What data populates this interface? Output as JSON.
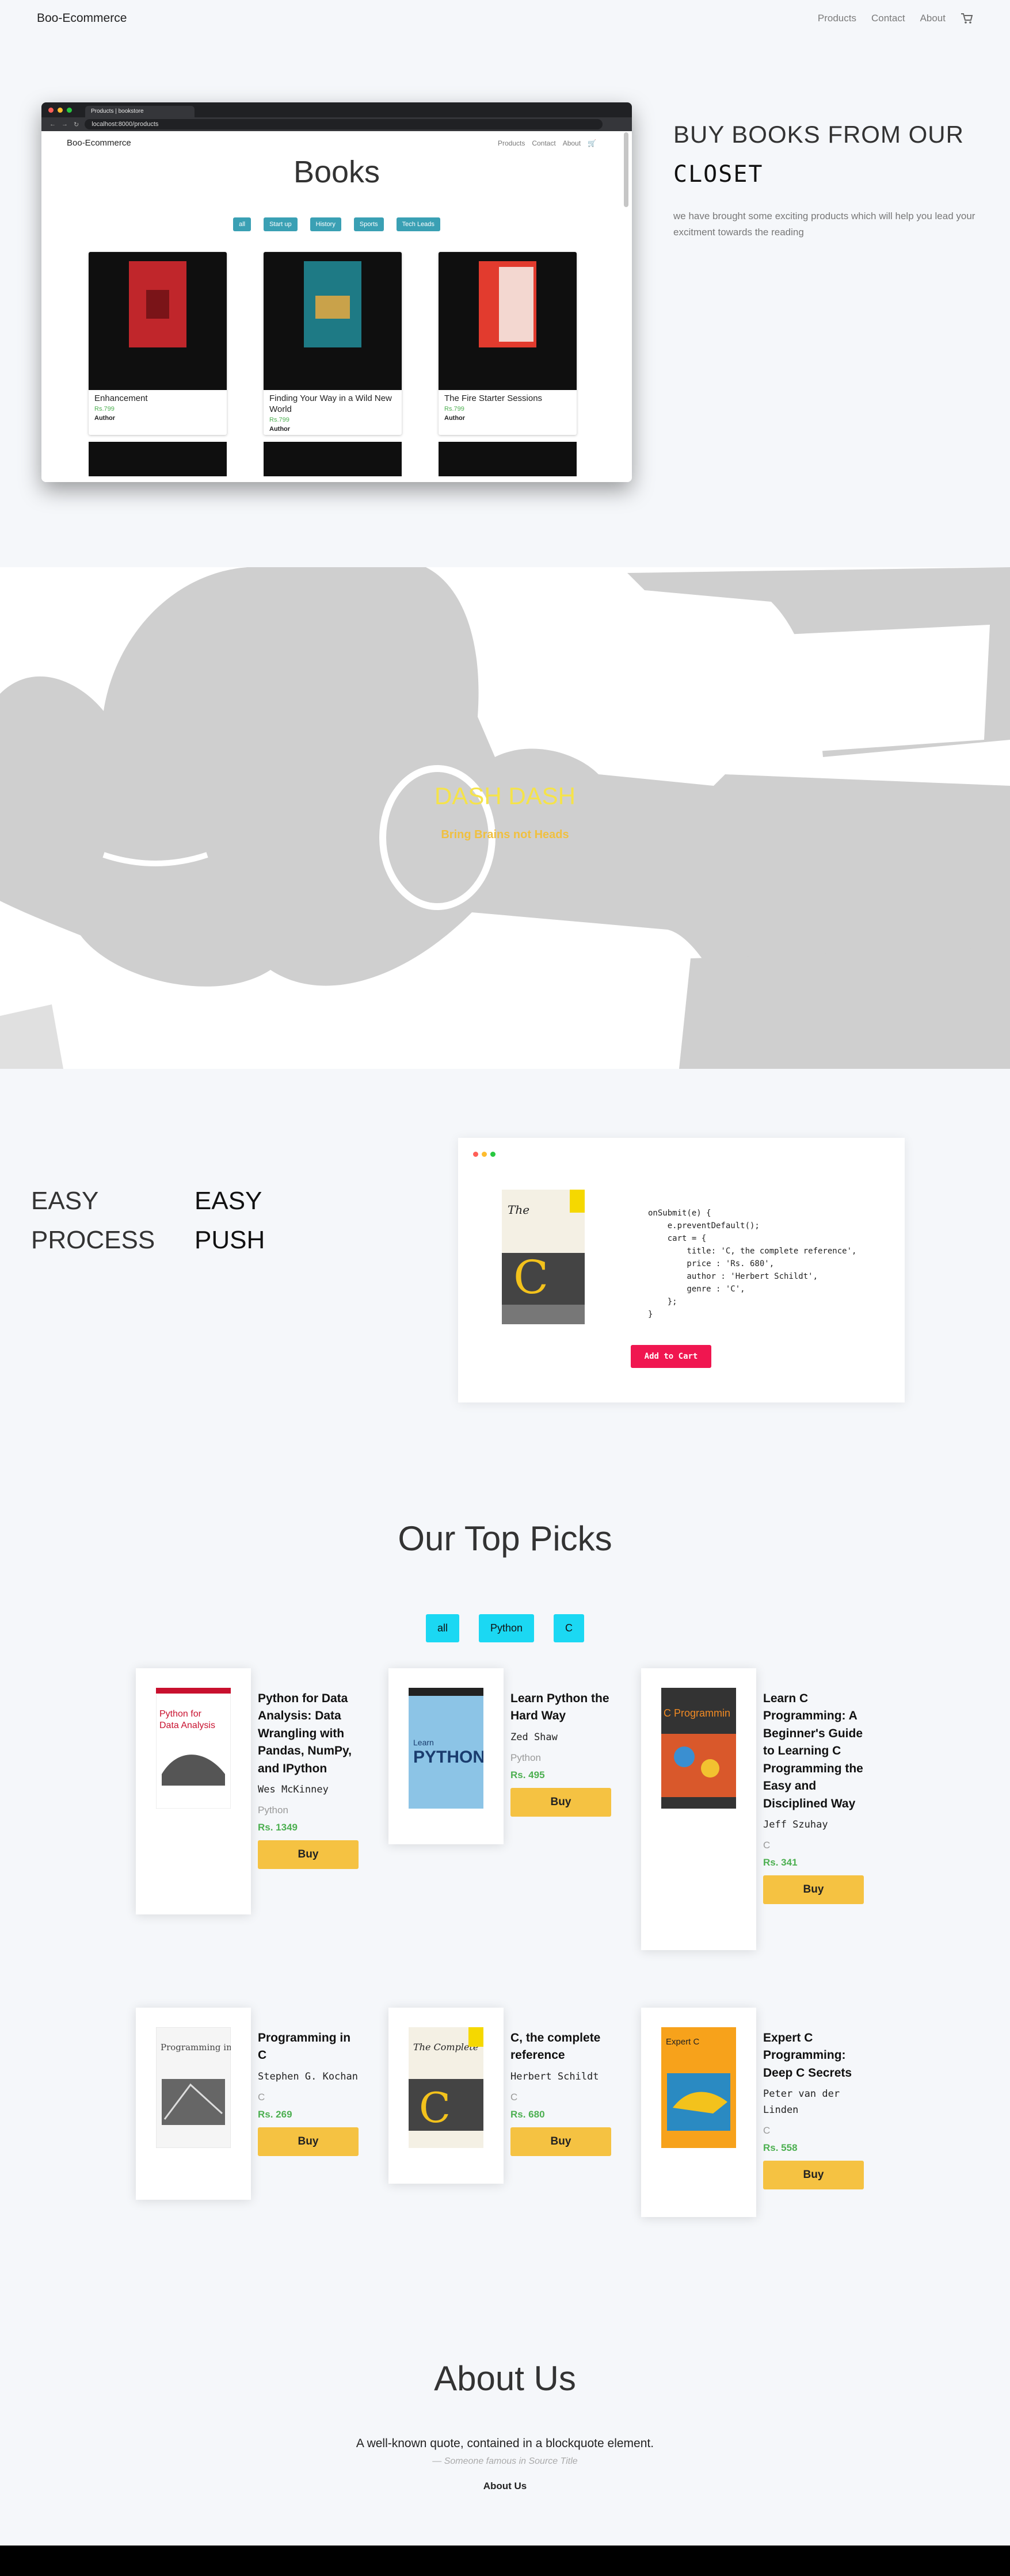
{
  "nav": {
    "brand": "Boo-Ecommerce",
    "links": [
      "Products",
      "Contact",
      "About"
    ],
    "cart_icon": "cart-icon"
  },
  "hero": {
    "browser": {
      "tab_title": "Products | bookstore",
      "url": "localhost:8000/products"
    },
    "inner": {
      "brand": "Boo-Ecommerce",
      "links": [
        "Products",
        "Contact",
        "About"
      ],
      "title": "Books",
      "filters": [
        "all",
        "Start up",
        "History",
        "Sports",
        "Tech Leads"
      ],
      "cards": [
        {
          "title": "Enhancement",
          "price": "Rs.799",
          "author": "Author"
        },
        {
          "title": "Finding Your Way in a Wild New World",
          "price": "Rs.799",
          "author": "Author"
        },
        {
          "title": "The Fire Starter Sessions",
          "price": "Rs.799",
          "author": "Author"
        }
      ]
    },
    "title_line1": "BUY BOOKS FROM OUR",
    "title_line2": "CLOSET",
    "subtitle": "we have brought some exciting products which will help you lead your excitment towards the reading"
  },
  "dash": {
    "title": "DASH DASH",
    "subtitle": "Bring Brains not Heads"
  },
  "easy": {
    "left": [
      "EASY",
      "PROCESS"
    ],
    "right": [
      "EASY",
      "PUSH"
    ],
    "code": "onSubmit(e) {\n    e.preventDefault();\n    cart = {\n        title: 'C, the complete reference',\n        price : 'Rs. 680',\n        author : 'Herbert Schildt',\n        genre : 'C',\n    };\n}",
    "button": "Add to Cart"
  },
  "top_picks": {
    "title": "Our Top Picks",
    "filters": [
      "all",
      "Python",
      "C"
    ],
    "buy_label": "Buy",
    "items": [
      {
        "title": "Python for Data Analysis: Data Wrangling with Pandas, NumPy, and IPython",
        "author": "Wes McKinney",
        "category": "Python",
        "price": "Rs. 1349"
      },
      {
        "title": "Learn Python the Hard Way",
        "author": "Zed Shaw",
        "category": "Python",
        "price": "Rs. 495"
      },
      {
        "title": "Learn C Programming: A Beginner's Guide to Learning C Programming the Easy and Disciplined Way",
        "author": "Jeff Szuhay",
        "category": "C",
        "price": "Rs. 341"
      },
      {
        "title": "Programming in C",
        "author": "Stephen G. Kochan",
        "category": "C",
        "price": "Rs. 269"
      },
      {
        "title": "C, the complete reference",
        "author": "Herbert Schildt",
        "category": "C",
        "price": "Rs. 680"
      },
      {
        "title": "Expert C Programming: Deep C Secrets",
        "author": "Peter van der Linden",
        "category": "C",
        "price": "Rs. 558"
      }
    ]
  },
  "about": {
    "title": "About Us",
    "quote": "A well-known quote, contained in a blockquote element.",
    "footer": "— Someone famous in Source Title",
    "link": "About Us"
  },
  "colors": {
    "accent_teal": "#3aa0b4",
    "filter_cyan": "#1bd8f3",
    "buy_yellow": "#f5c242",
    "add_cart_red": "#f01650",
    "price_green": "#4caf50"
  }
}
